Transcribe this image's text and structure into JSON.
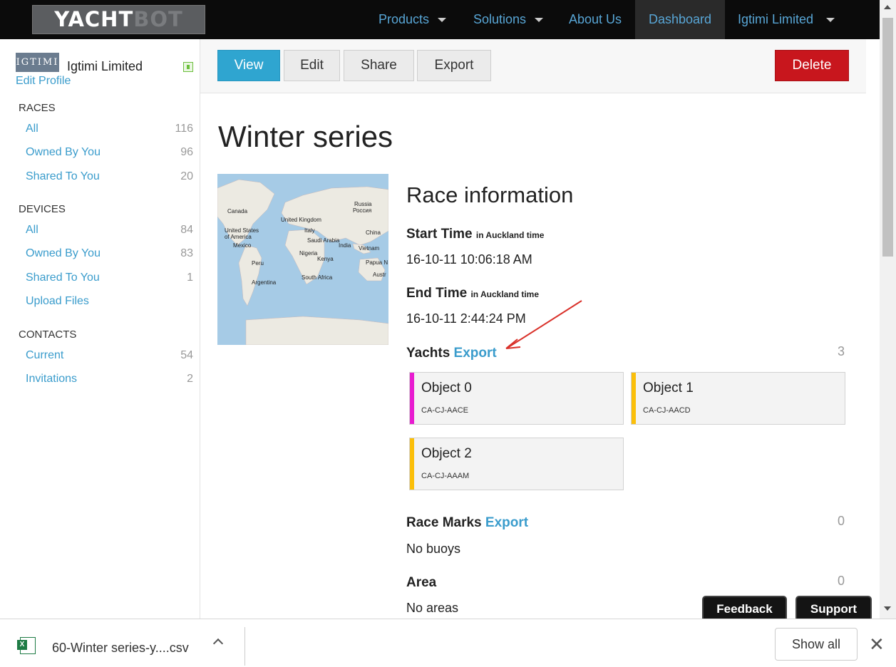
{
  "nav": {
    "logo_a": "YACHT",
    "logo_b": "BOT",
    "products": "Products",
    "solutions": "Solutions",
    "about": "About Us",
    "dashboard": "Dashboard",
    "account": "Igtimi Limited"
  },
  "sidebar": {
    "logo_text": "IGTIMI",
    "org_name": "Igtimi Limited",
    "edit_profile": "Edit Profile",
    "races_heading": "RACES",
    "races": [
      {
        "label": "All",
        "count": "116"
      },
      {
        "label": "Owned By You",
        "count": "96"
      },
      {
        "label": "Shared To You",
        "count": "20"
      }
    ],
    "devices_heading": "DEVICES",
    "devices": [
      {
        "label": "All",
        "count": "84"
      },
      {
        "label": "Owned By You",
        "count": "83"
      },
      {
        "label": "Shared To You",
        "count": "1"
      },
      {
        "label": "Upload Files",
        "count": ""
      }
    ],
    "contacts_heading": "CONTACTS",
    "contacts": [
      {
        "label": "Current",
        "count": "54"
      },
      {
        "label": "Invitations",
        "count": "2"
      }
    ]
  },
  "toolbar": {
    "view": "View",
    "edit": "Edit",
    "share": "Share",
    "export": "Export",
    "delete": "Delete"
  },
  "race": {
    "title": "Winter series",
    "section_title": "Race information",
    "start_label": "Start Time",
    "start_tz": "in Auckland time",
    "start_value": "16-10-11 10:06:18 AM",
    "end_label": "End Time",
    "end_tz": "in Auckland time",
    "end_value": "16-10-11 2:44:24 PM",
    "yachts_label": "Yachts",
    "yachts_export": "Export",
    "yachts_count": "3",
    "yachts": [
      {
        "name": "Object 0",
        "serial": "CA-CJ-AACE",
        "color": "#e81cd0"
      },
      {
        "name": "Object 1",
        "serial": "CA-CJ-AACD",
        "color": "#fbbf0a"
      },
      {
        "name": "Object 2",
        "serial": "CA-CJ-AAAM",
        "color": "#fbbf0a"
      }
    ],
    "marks_label": "Race Marks",
    "marks_export": "Export",
    "marks_count": "0",
    "marks_value": "No buoys",
    "area_label": "Area",
    "area_count": "0",
    "area_value": "No areas"
  },
  "map_labels": {
    "canada": "Canada",
    "russia": "Russia",
    "russia_native": "Россия",
    "uk": "United Kingdom",
    "usa": "United States of America",
    "italy": "Italy",
    "china": "China",
    "saudi": "Saudi Arabia",
    "mexico": "Mexico",
    "india": "India",
    "vietnam": "Vietnam",
    "nigeria": "Nigeria",
    "peru": "Peru",
    "kenya": "Kenya",
    "png": "Papua N",
    "argentina": "Argentina",
    "south_africa": "South Africa",
    "australia": "Austr"
  },
  "floating": {
    "feedback": "Feedback",
    "support": "Support"
  },
  "download": {
    "filename": "60-Winter series-y....csv",
    "show_all": "Show all"
  }
}
